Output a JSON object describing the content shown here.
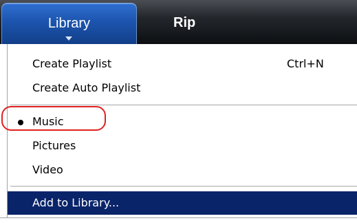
{
  "tabs": {
    "library_label": "Library",
    "rip_label": "Rip"
  },
  "menu": {
    "create_playlist": {
      "label": "Create Playlist",
      "shortcut": "Ctrl+N"
    },
    "create_auto_playlist": {
      "label": "Create Auto Playlist"
    },
    "music": {
      "label": "Music",
      "checked": true
    },
    "pictures": {
      "label": "Pictures"
    },
    "video": {
      "label": "Video"
    },
    "add_to_library": {
      "label": "Add to Library..."
    }
  },
  "colors": {
    "tab_active": "#1c54ae",
    "menu_selection": "#0a246a",
    "annotation_red": "#e02020"
  }
}
